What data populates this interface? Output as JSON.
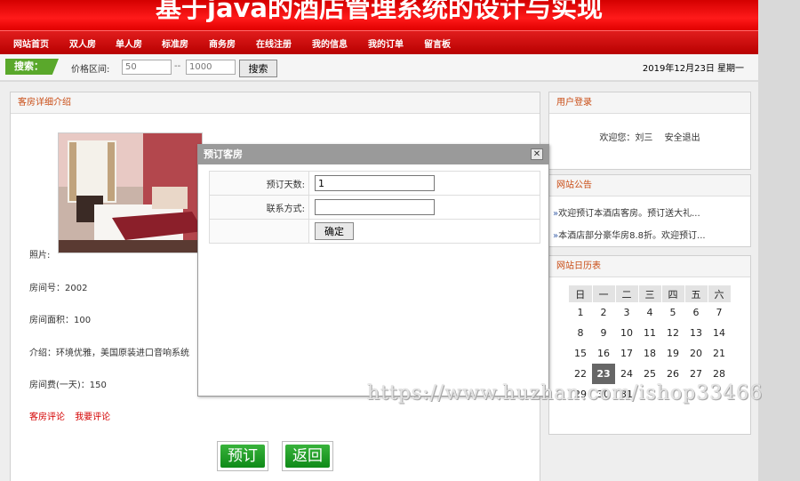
{
  "site_title": "基于java的酒店管理系统的设计与实现",
  "nav": [
    "网站首页",
    "双人房",
    "单人房",
    "标准房",
    "商务房",
    "在线注册",
    "我的信息",
    "我的订单",
    "留言板"
  ],
  "search": {
    "tag": "搜索：",
    "price_label": "价格区间:",
    "min_placeholder": "50",
    "separator": "--",
    "max_placeholder": "1000",
    "button": "搜索"
  },
  "date": "2019年12月23日 星期一",
  "room": {
    "heading": "客房详细介绍",
    "photo_label": "照片:",
    "number": "房间号：2002",
    "area": "房间面积：100",
    "intro": "介绍：环境优雅，美国原装进口音响系统",
    "price": "房间费(一天)：150",
    "links": [
      "客房评论",
      "我要评论"
    ],
    "book_button": "预订",
    "back_button": "返回"
  },
  "dialog": {
    "title": "预订客房",
    "close": "✕",
    "days_label": "预订天数:",
    "days_value": "1",
    "contact_label": "联系方式:",
    "contact_value": "",
    "confirm": "确定"
  },
  "login": {
    "heading": "用户登录",
    "welcome": "欢迎您：刘三",
    "logout": "安全退出"
  },
  "notice": {
    "heading": "网站公告",
    "items": [
      "欢迎预订本酒店客房。预订送大礼...",
      "本酒店部分豪华房8.8折。欢迎预订..."
    ]
  },
  "calendar": {
    "heading": "网站日历表",
    "weekdays": [
      "日",
      "一",
      "二",
      "三",
      "四",
      "五",
      "六"
    ],
    "weeks": [
      [
        "1",
        "2",
        "3",
        "4",
        "5",
        "6",
        "7"
      ],
      [
        "8",
        "9",
        "10",
        "11",
        "12",
        "13",
        "14"
      ],
      [
        "15",
        "16",
        "17",
        "18",
        "19",
        "20",
        "21"
      ],
      [
        "22",
        "23",
        "24",
        "25",
        "26",
        "27",
        "28"
      ],
      [
        "29",
        "30",
        "31",
        "",
        "",
        "",
        ""
      ]
    ],
    "today": "23"
  },
  "watermark": "https://www.huzhan.com/ishop33466",
  "colors": {
    "brand_red": "#d40000",
    "accent_green": "#5aa82b",
    "panel_title": "#c94c14"
  }
}
